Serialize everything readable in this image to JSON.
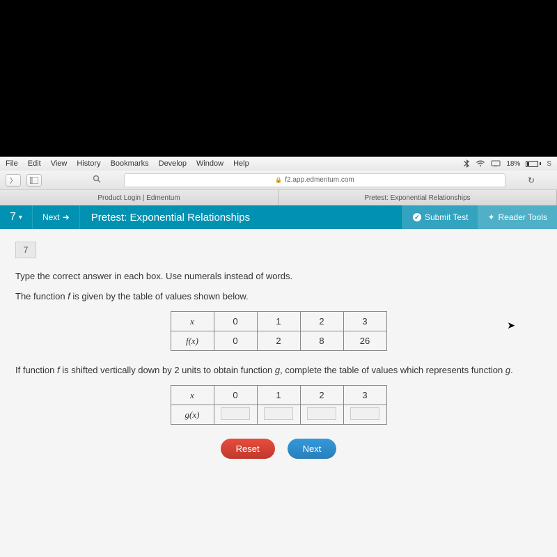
{
  "menubar": {
    "items": [
      "File",
      "Edit",
      "View",
      "History",
      "Bookmarks",
      "Develop",
      "Window",
      "Help"
    ],
    "battery_pct": "18%"
  },
  "urlbar": {
    "host": "f2.app.edmentum.com"
  },
  "tabs": [
    {
      "label": "Product Login | Edmentum"
    },
    {
      "label": "Pretest: Exponential Relationships"
    }
  ],
  "header": {
    "qnum": "7",
    "next": "Next",
    "title": "Pretest: Exponential Relationships",
    "submit": "Submit Test",
    "reader": "Reader Tools"
  },
  "question": {
    "badge": "7",
    "line1": "Type the correct answer in each box. Use numerals instead of words.",
    "line2_pre": "The function ",
    "line2_f": "f",
    "line2_post": " is given by the table of values shown below.",
    "table_f": {
      "row1": [
        "x",
        "0",
        "1",
        "2",
        "3"
      ],
      "row2": [
        "f(x)",
        "0",
        "2",
        "8",
        "26"
      ]
    },
    "line3_pre": "If function ",
    "line3_f": "f",
    "line3_mid": " is shifted vertically down by 2 units to obtain function ",
    "line3_g": "g",
    "line3_post": ", complete the table of values which represents function ",
    "line3_g2": "g",
    "line3_end": ".",
    "table_g": {
      "row1": [
        "x",
        "0",
        "1",
        "2",
        "3"
      ],
      "row2_hdr": "g(x)"
    },
    "reset": "Reset",
    "next": "Next"
  }
}
